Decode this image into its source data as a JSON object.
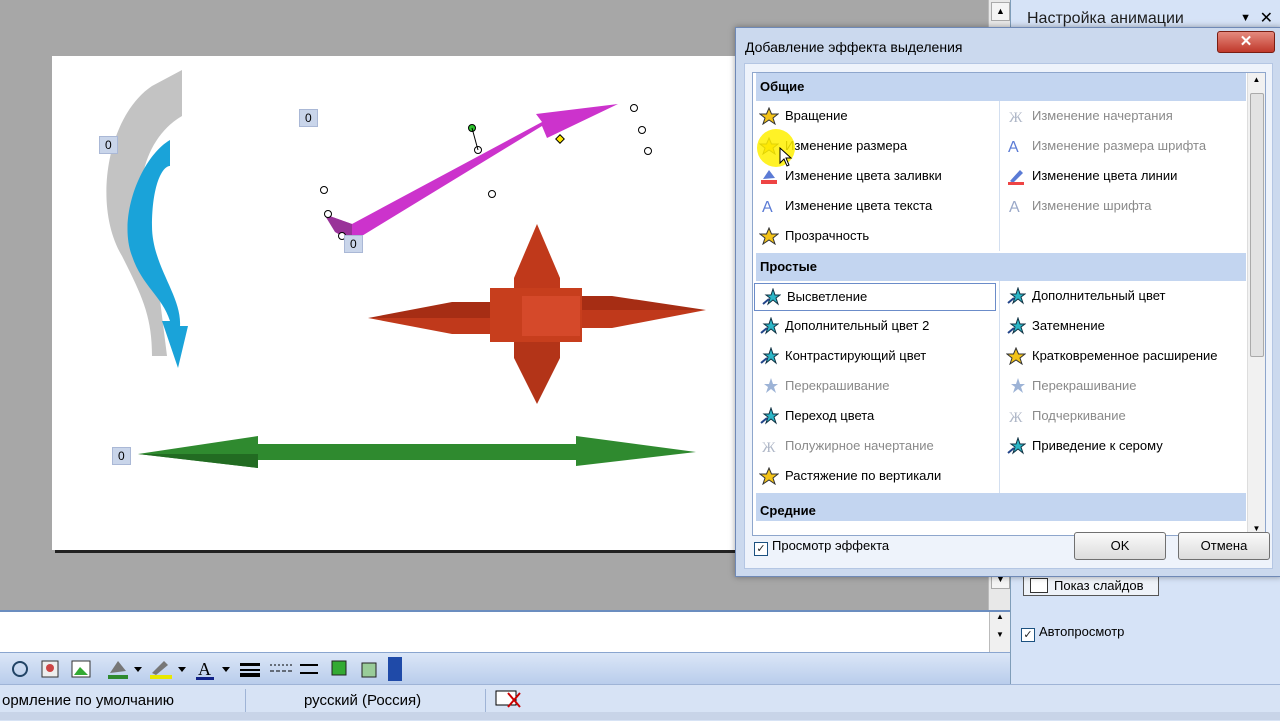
{
  "task_pane": {
    "title": "Настройка анимации",
    "slideshow_label": "Показ слайдов",
    "autopreview_label": "Автопросмотр",
    "autopreview_checked": "✓"
  },
  "slide": {
    "tags": [
      "0",
      "0",
      "0",
      "0"
    ],
    "colors": {
      "gray": "#c3c3c3",
      "blue": "#1aa3d9",
      "magenta": "#cc33cc",
      "red": "#c0391b",
      "green": "#2f8a2f"
    }
  },
  "status_bar": {
    "design": "ормление по умолчанию",
    "language": "русский (Россия)"
  },
  "dialog": {
    "title": "Добавление эффекта выделения",
    "close_glyph": "✕",
    "categories": {
      "general": "Общие",
      "simple": "Простые",
      "moderate": "Средние"
    },
    "general_left": [
      "Вращение",
      "Изменение размера",
      "Изменение цвета заливки",
      "Изменение цвета текста",
      "Прозрачность"
    ],
    "general_right": [
      "Изменение начертания",
      "Изменение размера шрифта",
      "Изменение цвета линии",
      "Изменение шрифта"
    ],
    "simple_left": [
      "Высветление",
      "Дополнительный цвет 2",
      "Контрастирующий цвет",
      "Перекрашивание",
      "Переход цвета",
      "Полужирное начертание",
      "Растяжение по вертикали"
    ],
    "simple_right": [
      "Дополнительный цвет",
      "Затемнение",
      "Кратковременное расширение",
      "Перекрашивание",
      "Подчеркивание",
      "Приведение к серому"
    ],
    "preview_label": "Просмотр эффекта",
    "preview_checked": "✓",
    "ok_label": "OK",
    "cancel_label": "Отмена"
  }
}
